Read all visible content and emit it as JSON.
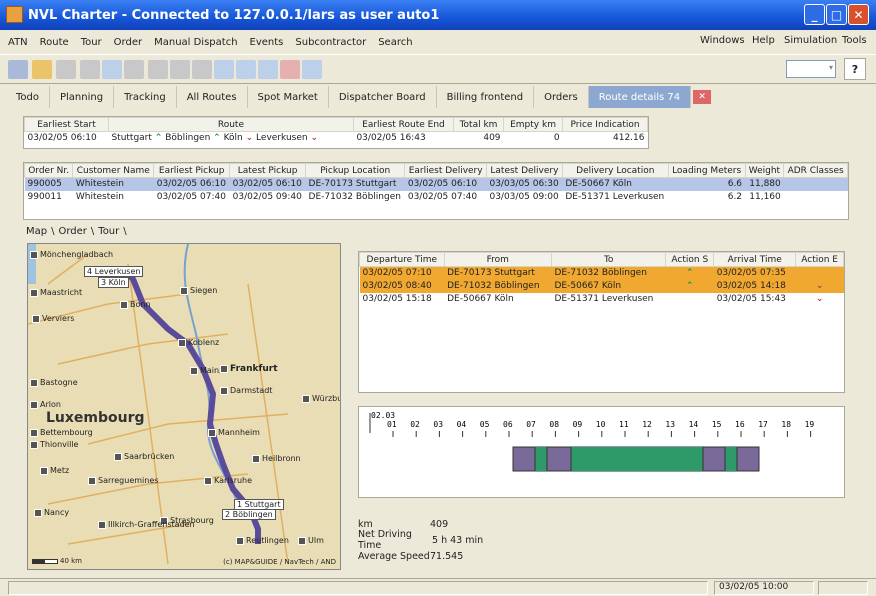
{
  "window": {
    "title": "NVL Charter - Connected to 127.0.0.1/lars as user auto1"
  },
  "menu": {
    "left": [
      "ATN",
      "Route",
      "Tour",
      "Order",
      "Manual Dispatch",
      "Events",
      "Subcontractor",
      "Search"
    ],
    "right": [
      "Windows",
      "Help",
      "Simulation",
      "Tools"
    ]
  },
  "help_button": "?",
  "tabs": [
    "Todo",
    "Planning",
    "Tracking",
    "All Routes",
    "Spot Market",
    "Dispatcher Board",
    "Billing frontend",
    "Orders",
    "Route details 74"
  ],
  "route_summary": {
    "headers": [
      "Earliest Start",
      "Route",
      "Earliest Route End",
      "Total km",
      "Empty km",
      "Price Indication"
    ],
    "row": {
      "start": "03/02/05 06:10",
      "route_stops": [
        "Stuttgart",
        "Böblingen",
        "Köln",
        "Leverkusen"
      ],
      "end": "03/02/05 16:43",
      "total_km": "409",
      "empty_km": "0",
      "price": "412.16"
    }
  },
  "orders": {
    "headers": [
      "Order Nr.",
      "Customer Name",
      "Earliest Pickup",
      "Latest Pickup",
      "Pickup Location",
      "Earliest Delivery",
      "Latest Delivery",
      "Delivery Location",
      "Loading Meters",
      "Weight",
      "ADR Classes"
    ],
    "rows": [
      [
        "990005",
        "Whitestein",
        "03/02/05 06:10",
        "03/02/05 06:10",
        "DE-70173 Stuttgart",
        "03/02/05 06:10",
        "03/03/05 06:30",
        "DE-50667 Köln",
        "6.6",
        "11,880",
        ""
      ],
      [
        "990011",
        "Whitestein",
        "03/02/05 07:40",
        "03/02/05 09:40",
        "DE-71032 Böblingen",
        "03/02/05 07:40",
        "03/03/05 09:00",
        "DE-51371 Leverkusen",
        "6.2",
        "11,160",
        ""
      ]
    ]
  },
  "subtabs": [
    "Map",
    "Order",
    "Tour"
  ],
  "map": {
    "cities": [
      "Mönchengladbach",
      "Maastricht",
      "Verviers",
      "Bonn",
      "Siegen",
      "Koblenz",
      "Bastogne",
      "Mainz",
      "Frankfurt",
      "Darmstadt",
      "Arlon",
      "Würzburg",
      "Bettembourg",
      "Thionville",
      "Mannheim",
      "Saarbrücken",
      "Heilbronn",
      "Metz",
      "Sarreguemines",
      "Karlsruhe",
      "Nancy",
      "Strasbourg",
      "Illkirch-Graffenstaden",
      "Reutlingen",
      "Ulm"
    ],
    "big_label": "Luxembourg",
    "markers": [
      "4 Leverkusen",
      "3 Köln",
      "1 Stuttgart",
      "2 Böblingen"
    ],
    "scale": "40 km",
    "copyright": "(c) MAP&GUIDE / NavTech / AND",
    "colors": {
      "route": "#5A4C9A",
      "water": "#9EC4E0",
      "land": "#E9DDB5"
    }
  },
  "legs": {
    "headers": [
      "Departure Time",
      "From",
      "To",
      "Action S",
      "Arrival Time",
      "Action E"
    ],
    "rows": [
      {
        "dep": "03/02/05 07:10",
        "from": "DE-70173 Stuttgart",
        "to": "DE-71032 Böblingen",
        "action_s": "^",
        "arr": "03/02/05 07:35",
        "action_e": ""
      },
      {
        "dep": "03/02/05 08:40",
        "from": "DE-71032 Böblingen",
        "to": "DE-50667 Köln",
        "action_s": "^",
        "arr": "03/02/05 14:18",
        "action_e": "v"
      },
      {
        "dep": "03/02/05 15:18",
        "from": "DE-50667 Köln",
        "to": "DE-51371 Leverkusen",
        "action_s": "",
        "arr": "03/02/05 15:43",
        "action_e": "v"
      }
    ]
  },
  "timeline": {
    "date": "02.03",
    "hours": [
      "01",
      "02",
      "03",
      "04",
      "05",
      "06",
      "07",
      "08",
      "09",
      "10",
      "11",
      "12",
      "13",
      "14",
      "15",
      "16",
      "17",
      "18",
      "19"
    ],
    "colors": {
      "drive": "#2E9A6A",
      "wait": "#7A6A9A"
    }
  },
  "stats": {
    "km_label": "km",
    "km": "409",
    "driving_label": "Net Driving Time",
    "driving": "5 h 43 min",
    "speed_label": "Average Speed",
    "speed": "71.545"
  },
  "status": {
    "datetime": "03/02/05 10:00"
  }
}
